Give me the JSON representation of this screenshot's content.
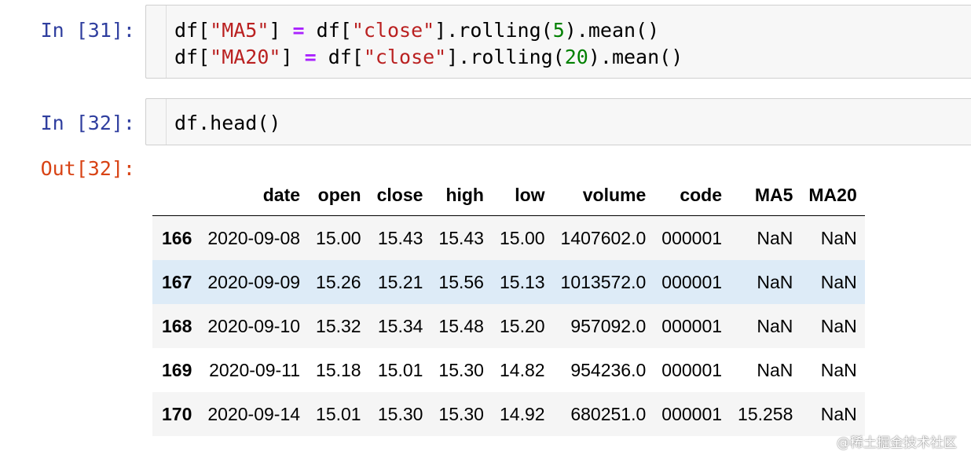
{
  "cells": [
    {
      "prompt": "In [31]:",
      "lines": [
        {
          "a": "df[",
          "s1": "\"MA5\"",
          "b": "] ",
          "op": "=",
          "c": " df[",
          "s2": "\"close\"",
          "d": "].rolling(",
          "n": "5",
          "e": ").mean()"
        },
        {
          "a": "df[",
          "s1": "\"MA20\"",
          "b": "] ",
          "op": "=",
          "c": " df[",
          "s2": "\"close\"",
          "d": "].rolling(",
          "n": "20",
          "e": ").mean()"
        }
      ]
    },
    {
      "prompt": "In [32]:",
      "code": "df.head()"
    }
  ],
  "output": {
    "prompt": "Out[32]:",
    "columns": [
      "",
      "date",
      "open",
      "close",
      "high",
      "low",
      "volume",
      "code",
      "MA5",
      "MA20"
    ],
    "rows": [
      {
        "index": "166",
        "date": "2020-09-08",
        "open": "15.00",
        "close": "15.43",
        "high": "15.43",
        "low": "15.00",
        "volume": "1407602.0",
        "code": "000001",
        "MA5": "NaN",
        "MA20": "NaN"
      },
      {
        "index": "167",
        "date": "2020-09-09",
        "open": "15.26",
        "close": "15.21",
        "high": "15.56",
        "low": "15.13",
        "volume": "1013572.0",
        "code": "000001",
        "MA5": "NaN",
        "MA20": "NaN"
      },
      {
        "index": "168",
        "date": "2020-09-10",
        "open": "15.32",
        "close": "15.34",
        "high": "15.48",
        "low": "15.20",
        "volume": "957092.0",
        "code": "000001",
        "MA5": "NaN",
        "MA20": "NaN"
      },
      {
        "index": "169",
        "date": "2020-09-11",
        "open": "15.18",
        "close": "15.01",
        "high": "15.30",
        "low": "14.82",
        "volume": "954236.0",
        "code": "000001",
        "MA5": "NaN",
        "MA20": "NaN"
      },
      {
        "index": "170",
        "date": "2020-09-14",
        "open": "15.01",
        "close": "15.30",
        "high": "15.30",
        "low": "14.92",
        "volume": "680251.0",
        "code": "000001",
        "MA5": "15.258",
        "MA20": "NaN"
      }
    ],
    "hover_row_index": "167"
  },
  "watermark": "@稀土掘金技术社区",
  "colors": {
    "prompt_in": "#303F9F",
    "prompt_out": "#D84315",
    "string": "#BA2121",
    "operator": "#AA22FF",
    "number": "#008000",
    "row_hover": "#ddebf7"
  }
}
